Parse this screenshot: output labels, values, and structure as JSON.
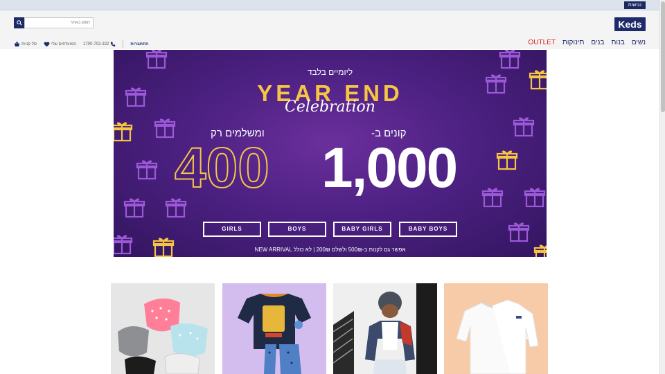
{
  "topbar": {
    "accessibility_label": "נגישות"
  },
  "header": {
    "logo": "Keds",
    "search": {
      "placeholder": "חפש באתר",
      "value": ""
    },
    "nav": [
      "נשים",
      "בנות",
      "בנים",
      "תינוקות",
      "OUTLET"
    ],
    "utils": {
      "login": "התחברות",
      "phone": "1700-702-322",
      "favorites": "המועדפים שלי",
      "cart": "סל קניות"
    }
  },
  "banner": {
    "subtitle": "ליומיים בלבד",
    "title": "YEAR END",
    "script": "Celebration",
    "buy_label": "קונים ב-",
    "buy_value": "1,000",
    "pay_label": "ומשלמים רק",
    "pay_value": "400",
    "buttons": [
      "GIRLS",
      "BOYS",
      "BABY GIRLS",
      "BABY BOYS"
    ],
    "footnote": "אפשר גם לקנות ב-500₪ ולשלם 200₪ | לא כולל NEW ARRIVAL"
  },
  "colors": {
    "brand": "#1d2b6b",
    "outlet": "#d42020",
    "gold": "#f6c543",
    "banner_purple": "#4d2183"
  },
  "product_cards": [
    {
      "image": "baby-bibs"
    },
    {
      "image": "kids-pajama-set"
    },
    {
      "image": "boy-in-jacket"
    },
    {
      "image": "baby-bodysuits"
    }
  ]
}
